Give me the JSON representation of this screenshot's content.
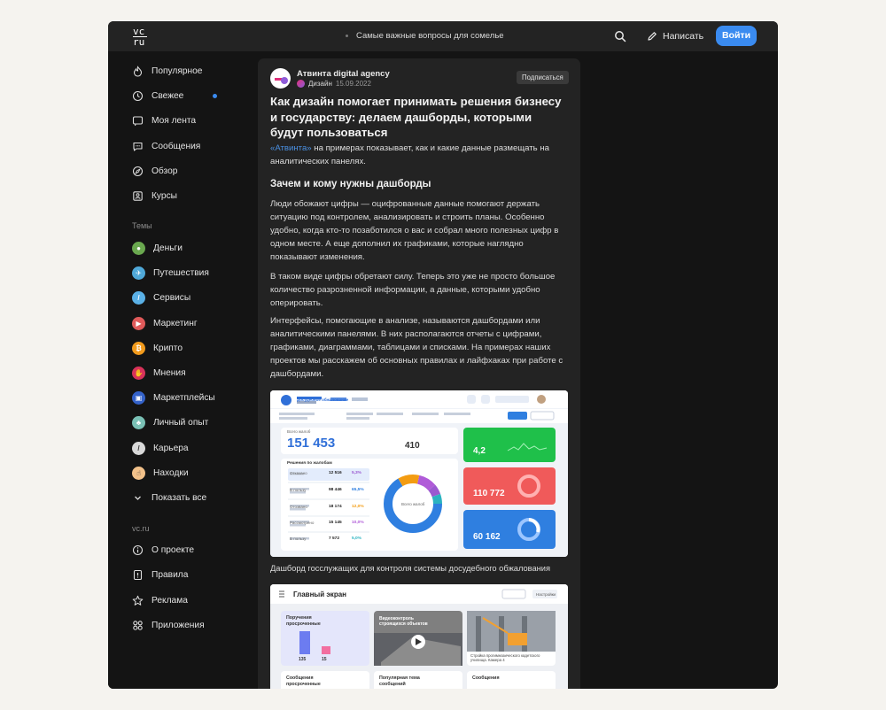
{
  "header": {
    "logo_top": "vc",
    "logo_bottom": "ru",
    "center_text": "Самые важные вопросы для сомелье",
    "write_label": "Написать",
    "login_label": "Войти"
  },
  "sidebar": {
    "main_items": [
      {
        "label": "Популярное",
        "icon": "flame-icon"
      },
      {
        "label": "Свежее",
        "icon": "clock-icon"
      },
      {
        "label": "Моя лента",
        "icon": "feed-icon"
      },
      {
        "label": "Сообщения",
        "icon": "chat-icon"
      },
      {
        "label": "Обзор",
        "icon": "compass-icon"
      },
      {
        "label": "Курсы",
        "icon": "courses-icon"
      }
    ],
    "topics_header": "Темы",
    "topics": [
      {
        "label": "Деньги",
        "color": "#6aa84f"
      },
      {
        "label": "Путешествия",
        "color": "#4fa8d8"
      },
      {
        "label": "Сервисы",
        "color": "#5ab0e6"
      },
      {
        "label": "Маркетинг",
        "color": "#e05a5a"
      },
      {
        "label": "Крипто",
        "color": "#f29b1d"
      },
      {
        "label": "Мнения",
        "color": "#d8325a"
      },
      {
        "label": "Маркетплейсы",
        "color": "#3462c9"
      },
      {
        "label": "Личный опыт",
        "color": "#7ac0b5"
      },
      {
        "label": "Карьера",
        "color": "#d9d9d9"
      },
      {
        "label": "Находки",
        "color": "#f2c18a"
      }
    ],
    "show_all": "Показать все",
    "vc_header": "vc.ru",
    "vc_items": [
      {
        "label": "О проекте",
        "icon": "info-icon"
      },
      {
        "label": "Правила",
        "icon": "rules-icon"
      },
      {
        "label": "Реклама",
        "icon": "star-icon"
      },
      {
        "label": "Приложения",
        "icon": "apps-icon"
      }
    ]
  },
  "article": {
    "author": "Атвинта digital agency",
    "category": "Дизайн",
    "date": "15.09.2022",
    "subscribe": "Подписаться",
    "title": "Как дизайн помогает принимать решения бизнесу и государству: делаем дашборды, которыми будут пользоваться",
    "lead_link": "«Атвинта»",
    "lead_rest": " на примерах показывает, как и какие данные размещать на аналитических панелях.",
    "h2": "Зачем и кому нужны дашборды",
    "p1": "Люди обожают цифры — оцифрованные данные помогают держать ситуацию под контролем, анализировать и строить планы. Особенно удобно, когда кто-то позаботился о вас и собрал много полезных цифр в одном месте. А еще дополнил их графиками, которые наглядно показывают изменения.",
    "p2": "В таком виде цифры обретают силу. Теперь это уже не просто большое количество разрозненной информации, а данные, которыми удобно оперировать.",
    "p3": "Интерфейсы, помогающие в анализе, называются дашбордами или аналитическими панелями. В них располагаются отчеты с цифрами, графиками, диаграммами, таблицами и списками. На примерах наших проектов мы расскажем об основных правилах и лайфхаках при работе с дашбордами.",
    "caption": "Дашборд госслужащих для контроля системы досудебного обжалования"
  },
  "dashboard1": {
    "brand": "Досудебное обжалование",
    "total_label": "Всего жалоб",
    "total_value": "151 453",
    "side_value": "410",
    "table_title": "Решения по жалобам",
    "rows": [
      {
        "label": "Отказано",
        "value": "12 516",
        "pct": "5,3%",
        "color": "#9b59d0"
      },
      {
        "label": "В пользу",
        "value": "98 446",
        "pct": "65,5%",
        "color": "#2f7fe0"
      },
      {
        "label": "Отозвано",
        "value": "18 174",
        "pct": "12,0%",
        "color": "#f39c12"
      },
      {
        "label": "Рассмотрено",
        "value": "15 145",
        "pct": "10,0%",
        "color": "#b05bd8"
      },
      {
        "label": "В пользу",
        "value": "7 572",
        "pct": "5,0%",
        "color": "#2bb3c0"
      }
    ],
    "donut_label": "Всего жалоб",
    "cards": [
      {
        "value": "4,2",
        "color": "#1fc04a"
      },
      {
        "value": "110 772",
        "color": "#f05a5a"
      },
      {
        "value": "60 162",
        "color": "#2f7fe0"
      }
    ]
  },
  "dashboard2": {
    "title": "Главный экран",
    "tab": "Настройки",
    "card1_title": "Поручения просроченные",
    "card1_values": [
      "135",
      "15"
    ],
    "card2_title": "Видеоконтроль строящихся объектов",
    "card3_caption": "Стройка прогимназического кадетского училища. Камера 4",
    "card4_title": "Сообщения просроченные",
    "card5_title": "Популярная тема сообщений",
    "card6_title": "Сообщения"
  }
}
